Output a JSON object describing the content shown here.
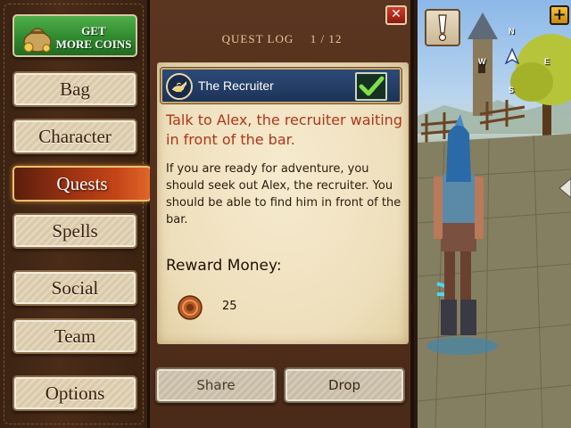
{
  "sidebar": {
    "coins_button": {
      "line1": "GET",
      "line2": "MORE COINS"
    },
    "items": [
      {
        "label": "Bag",
        "active": false
      },
      {
        "label": "Character",
        "active": false
      },
      {
        "label": "Quests",
        "active": true
      },
      {
        "label": "Spells",
        "active": false
      },
      {
        "label": "Social",
        "active": false
      },
      {
        "label": "Team",
        "active": false
      },
      {
        "label": "Options",
        "active": false
      }
    ]
  },
  "quest_log": {
    "title": "QUEST LOG",
    "page": "1 / 12",
    "close_label": "✕",
    "selected_quest": {
      "name": "The Recruiter",
      "completed": true,
      "summary": "Talk to Alex, the recruiter waiting in front of the bar.",
      "description": "If you are ready for adventure, you should seek out Alex, the recruiter. You should be able to find him in front of the bar."
    },
    "reward": {
      "label": "Reward Money:",
      "amount": "25",
      "icon": "copper-coin-icon"
    },
    "actions": {
      "share": "Share",
      "drop": "Drop"
    }
  },
  "game_view": {
    "alert_icon": "exclamation-icon",
    "plus_label": "+",
    "compass": {
      "n": "N",
      "e": "E",
      "w": "W",
      "s": "S"
    }
  },
  "colors": {
    "summary_text": "#b0351a",
    "active_tab": "#c44418",
    "coins_button": "#2f8a2e",
    "quest_item_bg": "#1c3358"
  }
}
